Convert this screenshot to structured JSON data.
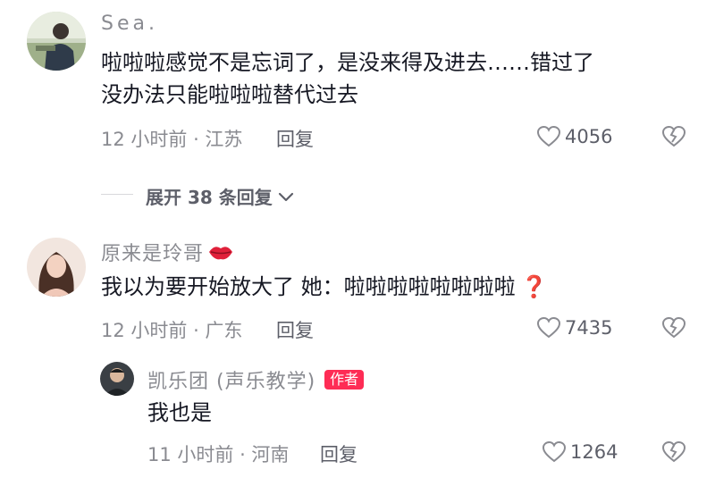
{
  "comments": [
    {
      "username": "Sea.",
      "text_line1": "啦啦啦感觉不是忘词了，是没来得及进去……错过了",
      "text_line2": "没办法只能啦啦啦替代过去",
      "meta": "12 小时前 · 江苏",
      "reply_label": "回复",
      "likes": "4056",
      "expand_label": "展开 38 条回复"
    },
    {
      "username": "原来是玲哥",
      "name_emoji": "lips-icon",
      "text": "我以为要开始放大了  她：啦啦啦啦啦啦啦啦",
      "text_emoji": "❓",
      "meta": "12 小时前 · 广东",
      "reply_label": "回复",
      "likes": "7435"
    }
  ],
  "reply": {
    "username": "凯乐团 (声乐教学)",
    "author_badge": "作者",
    "text": "我也是",
    "meta": "11 小时前 · 河南",
    "reply_label": "回复",
    "likes": "1264"
  },
  "colors": {
    "text": "#161823",
    "meta": "#8a8b91",
    "badge": "#fe2c55",
    "accent": "#fe2c55"
  }
}
